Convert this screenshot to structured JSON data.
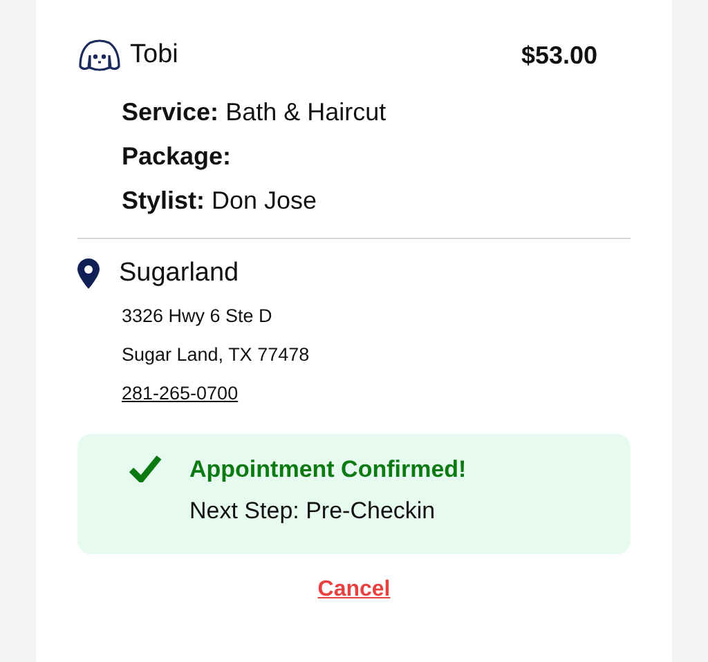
{
  "pet": {
    "name": "Tobi",
    "price": "$53.00"
  },
  "details": [
    "**Service:** Bath & Haircut",
    "**Package:**",
    "**Stylist:** Don Jose"
  ],
  "location": {
    "name": "Sugarland",
    "address_lines": [
      "3326 Hwy 6 Ste D",
      "Sugar Land, TX 77478"
    ],
    "phone": "281-265-0700"
  },
  "status": {
    "kind": "confirmed",
    "title": "Appointment Confirmed!",
    "next_step": "Next Step: Pre-Checkin"
  },
  "cancel_link": "Cancel"
}
